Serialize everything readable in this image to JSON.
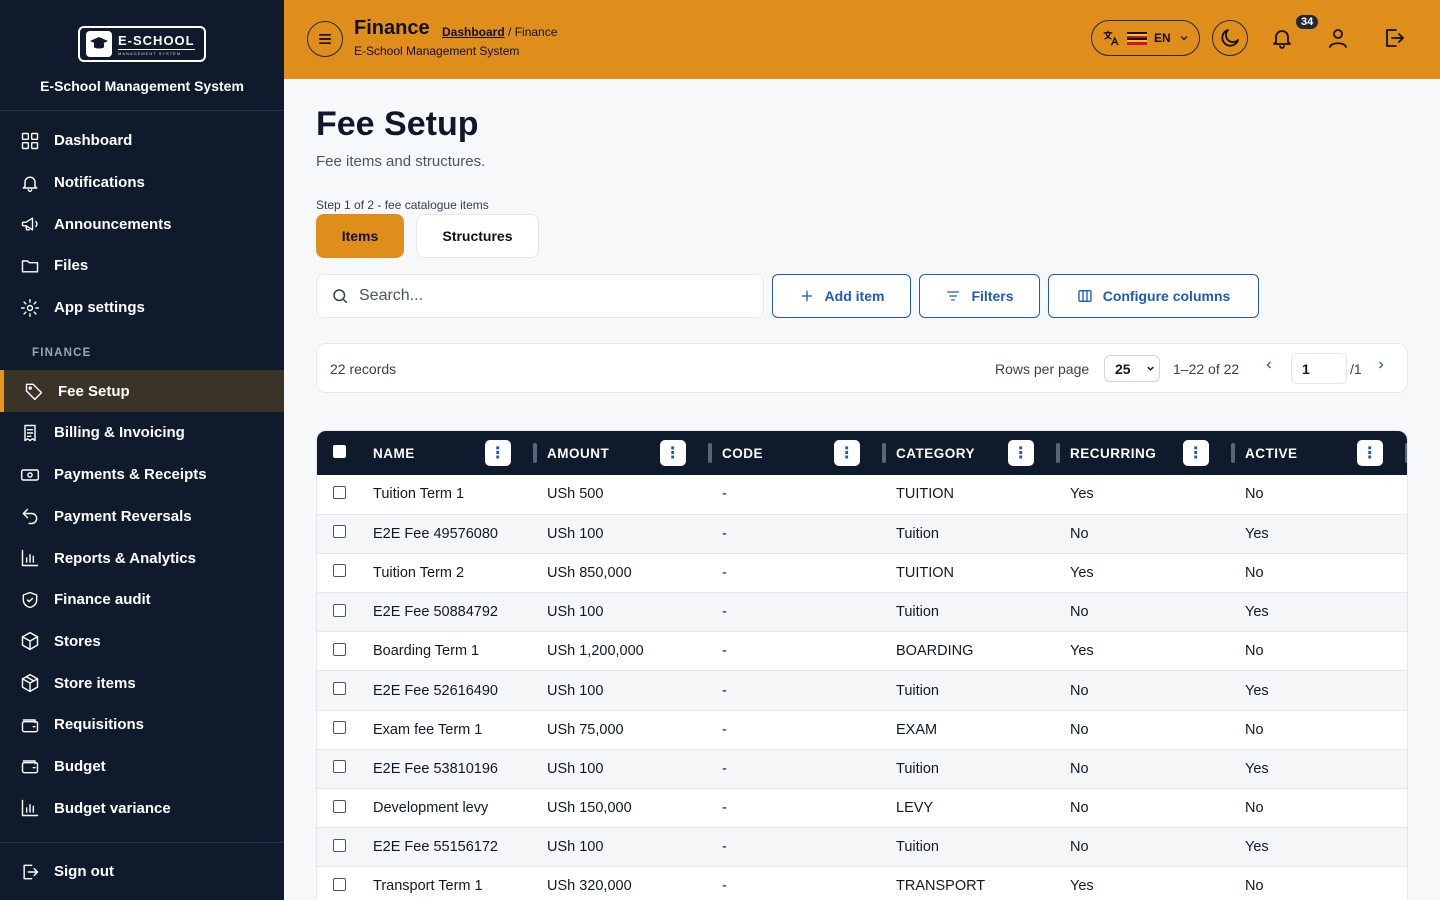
{
  "brand": {
    "logo_title": "E-SCHOOL",
    "logo_sub": "MANAGEMENT SYSTEM",
    "name": "E-School Management System"
  },
  "sidebar": {
    "main_items": [
      {
        "label": "Dashboard",
        "icon": "dashboard-icon"
      },
      {
        "label": "Notifications",
        "icon": "bell-icon"
      },
      {
        "label": "Announcements",
        "icon": "megaphone-icon"
      },
      {
        "label": "Files",
        "icon": "folder-icon"
      },
      {
        "label": "App settings",
        "icon": "gear-icon"
      }
    ],
    "section_label": "FINANCE",
    "finance_items": [
      {
        "label": "Fee Setup",
        "icon": "tag-icon",
        "active": true
      },
      {
        "label": "Billing & Invoicing",
        "icon": "invoice-icon"
      },
      {
        "label": "Payments & Receipts",
        "icon": "money-icon"
      },
      {
        "label": "Payment Reversals",
        "icon": "undo-icon"
      },
      {
        "label": "Reports & Analytics",
        "icon": "bar-chart-icon"
      },
      {
        "label": "Finance audit",
        "icon": "shield-check-icon"
      },
      {
        "label": "Stores",
        "icon": "box-icon"
      },
      {
        "label": "Store items",
        "icon": "package-icon"
      },
      {
        "label": "Requisitions",
        "icon": "wallet-icon"
      },
      {
        "label": "Budget",
        "icon": "wallet-icon"
      },
      {
        "label": "Budget variance",
        "icon": "bar-chart-icon"
      }
    ],
    "sign_out": "Sign out"
  },
  "header": {
    "title": "Finance",
    "breadcrumb_link": "Dashboard",
    "breadcrumb_sep": " / ",
    "breadcrumb_current": "Finance",
    "subtitle": "E-School Management System",
    "language": "EN",
    "notification_count": "34",
    "accent_color": "#e08e1b"
  },
  "page": {
    "title": "Fee Setup",
    "subtitle": "Fee items and structures.",
    "step_text": "Step 1 of 2 - fee catalogue items",
    "tabs": [
      {
        "label": "Items",
        "active": true
      },
      {
        "label": "Structures",
        "active": false
      }
    ],
    "search_placeholder": "Search...",
    "add_item": "Add item",
    "filters": "Filters",
    "configure_columns": "Configure columns"
  },
  "pager": {
    "records": "22 records",
    "rows_per_page_label": "Rows per page",
    "rows_per_page_value": "25",
    "range": "1–22 of 22",
    "page_value": "1",
    "page_total": "/1"
  },
  "table": {
    "columns": [
      "NAME",
      "AMOUNT",
      "CODE",
      "CATEGORY",
      "RECURRING",
      "ACTIVE"
    ],
    "rows": [
      {
        "name": "Tuition Term 1",
        "amount": "USh 500",
        "code": "-",
        "category": "TUITION",
        "recurring": "Yes",
        "active": "No"
      },
      {
        "name": "E2E Fee 49576080",
        "amount": "USh 100",
        "code": "-",
        "category": "Tuition",
        "recurring": "No",
        "active": "Yes"
      },
      {
        "name": "Tuition Term 2",
        "amount": "USh 850,000",
        "code": "-",
        "category": "TUITION",
        "recurring": "Yes",
        "active": "No"
      },
      {
        "name": "E2E Fee 50884792",
        "amount": "USh 100",
        "code": "-",
        "category": "Tuition",
        "recurring": "No",
        "active": "Yes"
      },
      {
        "name": "Boarding Term 1",
        "amount": "USh 1,200,000",
        "code": "-",
        "category": "BOARDING",
        "recurring": "Yes",
        "active": "No"
      },
      {
        "name": "E2E Fee 52616490",
        "amount": "USh 100",
        "code": "-",
        "category": "Tuition",
        "recurring": "No",
        "active": "Yes"
      },
      {
        "name": "Exam fee Term 1",
        "amount": "USh 75,000",
        "code": "-",
        "category": "EXAM",
        "recurring": "No",
        "active": "No"
      },
      {
        "name": "E2E Fee 53810196",
        "amount": "USh 100",
        "code": "-",
        "category": "Tuition",
        "recurring": "No",
        "active": "Yes"
      },
      {
        "name": "Development levy",
        "amount": "USh 150,000",
        "code": "-",
        "category": "LEVY",
        "recurring": "No",
        "active": "No"
      },
      {
        "name": "E2E Fee 55156172",
        "amount": "USh 100",
        "code": "-",
        "category": "Tuition",
        "recurring": "No",
        "active": "Yes"
      },
      {
        "name": "Transport Term 1",
        "amount": "USh 320,000",
        "code": "-",
        "category": "TRANSPORT",
        "recurring": "Yes",
        "active": "No"
      }
    ]
  }
}
